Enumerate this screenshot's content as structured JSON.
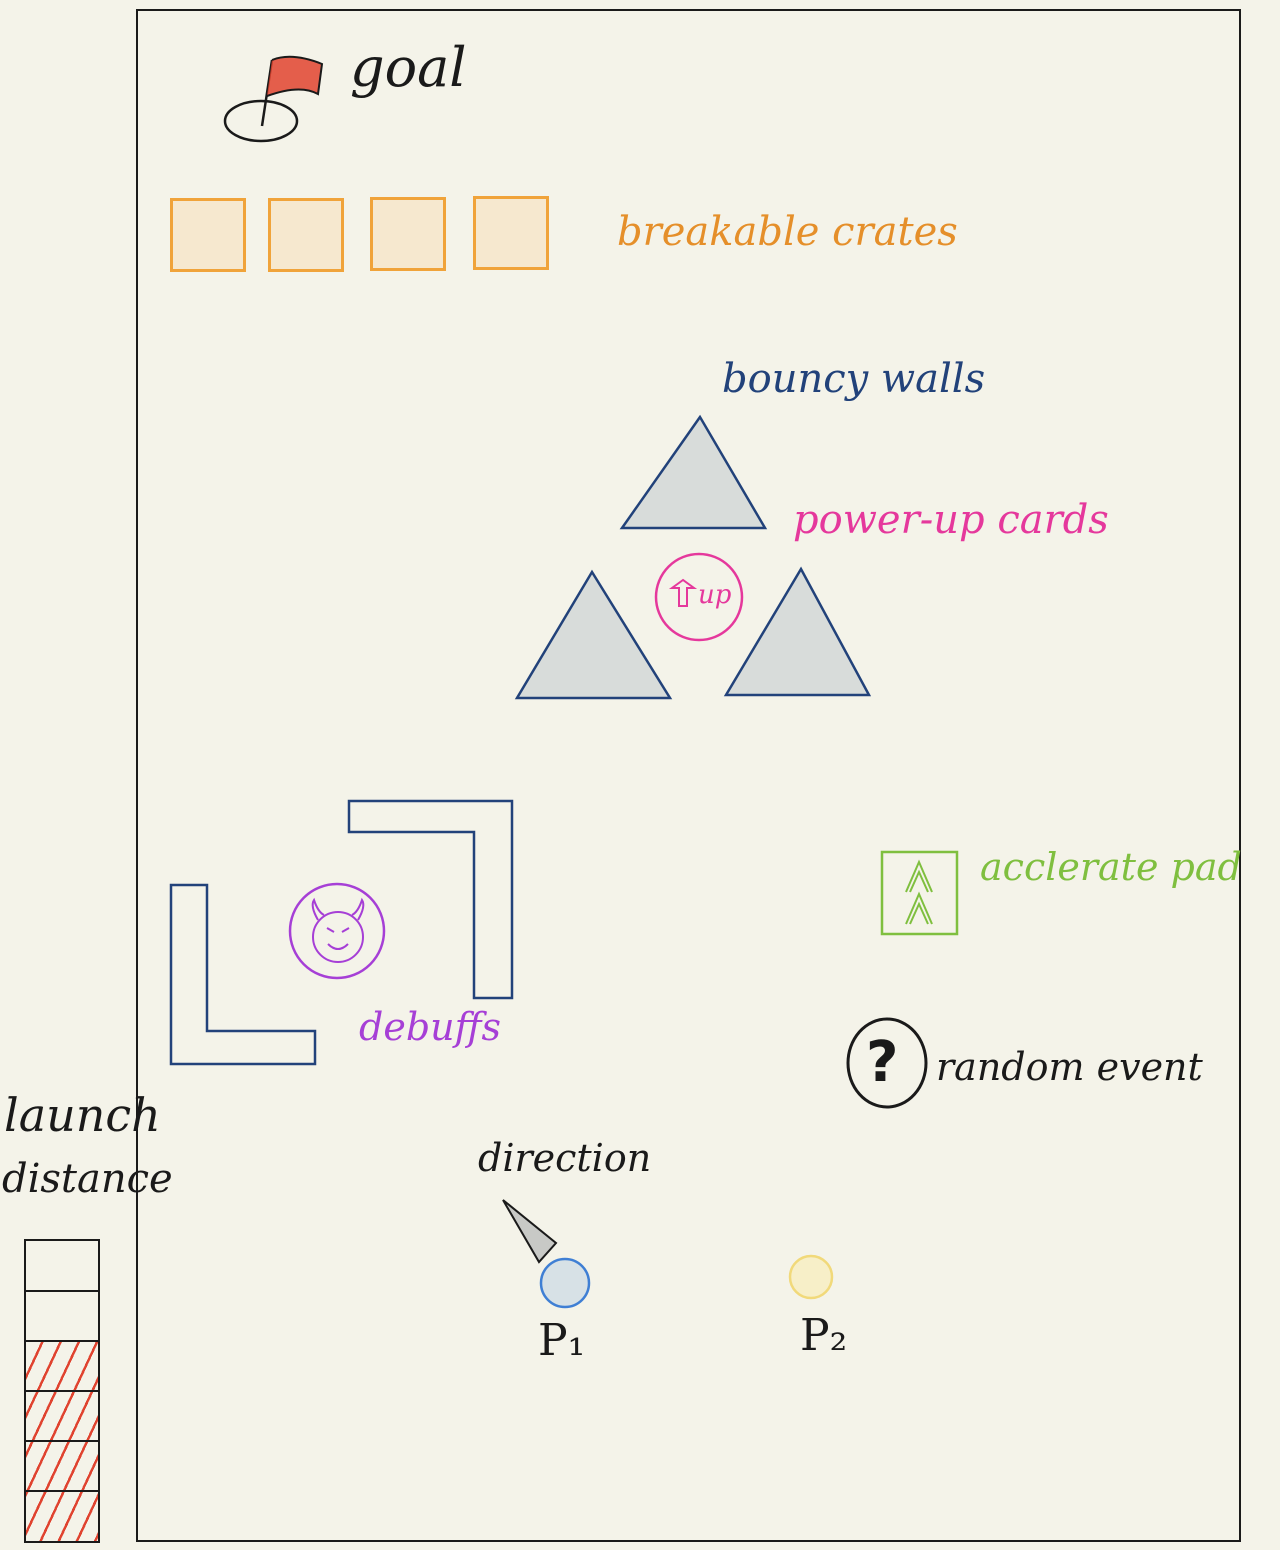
{
  "labels": {
    "goal": "goal",
    "breakable_crates": "breakable crates",
    "bouncy_walls": "bouncy walls",
    "power_up_cards": "power-up cards",
    "power_up_symbol": "up",
    "accelerate_pad": "acclerate pad",
    "debuffs": "debuffs",
    "random_event": "random event",
    "random_event_symbol": "?",
    "direction": "direction",
    "player1": "P₁",
    "player2": "P₂",
    "launch_distance_line1": "launch",
    "launch_distance_line2": "distance"
  },
  "launch_meter": {
    "segments": 6,
    "filled_segments": 4
  },
  "colors": {
    "border": "#1a1a1a",
    "background": "#f4f3e9",
    "crate": "#f0a33a",
    "wall": "#22427a",
    "wall_fill": "#d8dcda",
    "power_up": "#e5389c",
    "debuff": "#a63fd6",
    "accelerate": "#7fbf3f",
    "flag": "#e0432f",
    "player1": "#3f7fd4",
    "player2": "#f1d97a",
    "meter_fill": "#e0432f"
  }
}
